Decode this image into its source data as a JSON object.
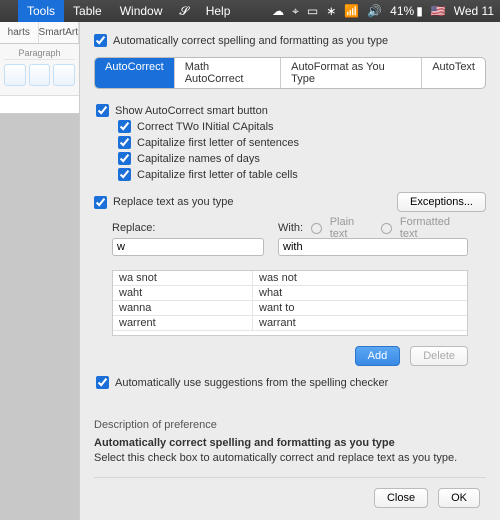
{
  "menubar": {
    "items": [
      "Tools",
      "Table",
      "Window",
      "",
      "Help"
    ],
    "selected_index": 0,
    "right": {
      "battery_pct": "41%",
      "clock": "Wed 11"
    }
  },
  "ribbon": {
    "tabs": [
      "harts",
      "SmartArt"
    ],
    "group_label": "Paragraph"
  },
  "dialog": {
    "auto_correct_label": "Automatically correct spelling and formatting as you type",
    "tabs": [
      "AutoCorrect",
      "Math AutoCorrect",
      "AutoFormat as You Type",
      "AutoText"
    ],
    "active_tab_index": 0,
    "smart_button_label": "Show AutoCorrect smart button",
    "options": [
      "Correct TWo INitial CApitals",
      "Capitalize first letter of sentences",
      "Capitalize names of days",
      "Capitalize first letter of table cells"
    ],
    "replace_section": {
      "label": "Replace text as you type",
      "exceptions_btn": "Exceptions...",
      "replace_title": "Replace:",
      "with_title": "With:",
      "plain_text": "Plain text",
      "formatted_text": "Formatted text",
      "replace_value": "w",
      "with_value": "with",
      "rows": [
        {
          "from": "wa snot",
          "to": "was not"
        },
        {
          "from": "waht",
          "to": "what"
        },
        {
          "from": "wanna",
          "to": "want to"
        },
        {
          "from": "warrent",
          "to": "warrant"
        }
      ],
      "add_btn": "Add",
      "delete_btn": "Delete"
    },
    "spellcheck_label": "Automatically use suggestions from the spelling checker",
    "description": {
      "heading": "Description of preference",
      "title": "Automatically correct spelling and formatting as you type",
      "body": "Select this check box to automatically correct and replace text as you type."
    },
    "footer": {
      "close": "Close",
      "ok": "OK"
    }
  }
}
